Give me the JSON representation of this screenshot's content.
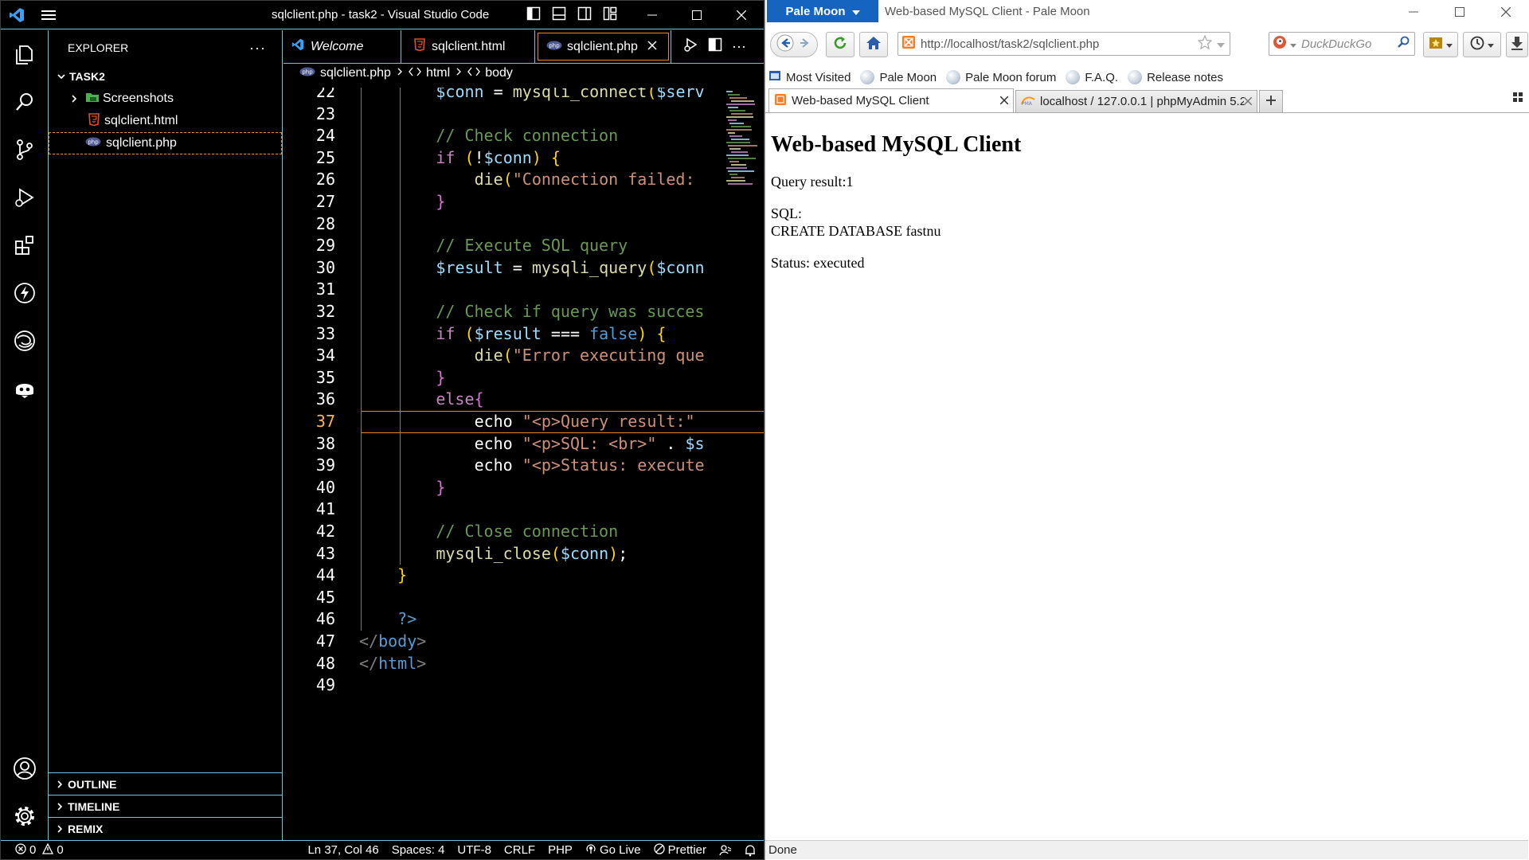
{
  "vscode": {
    "window_title": "sqlclient.php - task2 - Visual Studio Code",
    "explorer": {
      "header": "EXPLORER",
      "folder": "TASK2",
      "items": [
        {
          "label": "Screenshots",
          "kind": "folder"
        },
        {
          "label": "sqlclient.html",
          "kind": "html"
        },
        {
          "label": "sqlclient.php",
          "kind": "php"
        }
      ],
      "sections": [
        "OUTLINE",
        "TIMELINE",
        "REMIX"
      ]
    },
    "tabs": [
      {
        "label": "Welcome",
        "italic": true
      },
      {
        "label": "sqlclient.html"
      },
      {
        "label": "sqlclient.php",
        "active": true
      }
    ],
    "breadcrumb": [
      "sqlclient.php",
      "html",
      "body"
    ],
    "code_lines": [
      {
        "n": "22",
        "text": "        $conn = mysqli_connect($serv"
      },
      {
        "n": "23",
        "text": ""
      },
      {
        "n": "24",
        "text": "        // Check connection"
      },
      {
        "n": "25",
        "text": "        if (!$conn) {"
      },
      {
        "n": "26",
        "text": "            die(\"Connection failed:"
      },
      {
        "n": "27",
        "text": "        }"
      },
      {
        "n": "28",
        "text": ""
      },
      {
        "n": "29",
        "text": "        // Execute SQL query"
      },
      {
        "n": "30",
        "text": "        $result = mysqli_query($conn"
      },
      {
        "n": "31",
        "text": ""
      },
      {
        "n": "32",
        "text": "        // Check if query was succes"
      },
      {
        "n": "33",
        "text": "        if ($result === false) {"
      },
      {
        "n": "34",
        "text": "            die(\"Error executing que"
      },
      {
        "n": "35",
        "text": "        }"
      },
      {
        "n": "36",
        "text": "        else{"
      },
      {
        "n": "37",
        "text": "            echo \"<p>Query result:\""
      },
      {
        "n": "38",
        "text": "            echo \"<p>SQL: <br>\" . $s"
      },
      {
        "n": "39",
        "text": "            echo \"<p>Status: execute"
      },
      {
        "n": "40",
        "text": "        }"
      },
      {
        "n": "41",
        "text": ""
      },
      {
        "n": "42",
        "text": "        // Close connection"
      },
      {
        "n": "43",
        "text": "        mysqli_close($conn);"
      },
      {
        "n": "44",
        "text": "    }"
      },
      {
        "n": "45",
        "text": ""
      },
      {
        "n": "46",
        "text": "    ?>"
      },
      {
        "n": "47",
        "text": "</body>"
      },
      {
        "n": "48",
        "text": "</html>"
      },
      {
        "n": "49",
        "text": ""
      }
    ],
    "current_line": "37",
    "status": {
      "errors": "0",
      "warnings": "0",
      "position": "Ln 37, Col 46",
      "spaces": "Spaces: 4",
      "encoding": "UTF-8",
      "eol": "CRLF",
      "language": "PHP",
      "golive": "Go Live",
      "prettier": "Prettier"
    }
  },
  "palemoon": {
    "app_button": "Pale Moon",
    "window_title": "Web-based MySQL Client - Pale Moon",
    "url": "http://localhost/task2/sqlclient.php",
    "search_placeholder": "DuckDuckGo",
    "bookmarks": [
      "Most Visited",
      "Pale Moon",
      "Pale Moon forum",
      "F.A.Q.",
      "Release notes"
    ],
    "tabs": [
      {
        "label": "Web-based MySQL Client",
        "active": true
      },
      {
        "label": "localhost / 127.0.0.1 | phpMyAdmin 5.2"
      }
    ],
    "page": {
      "heading": "Web-based MySQL Client",
      "query_result": "Query result:1",
      "sql_label": "SQL:",
      "sql_text": "CREATE DATABASE fastnu",
      "status": "Status: executed"
    },
    "statusbar": "Done"
  }
}
